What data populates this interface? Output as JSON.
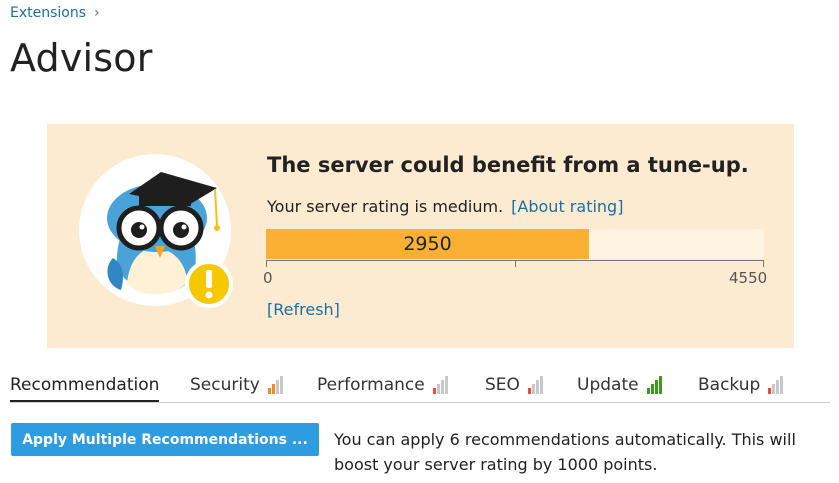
{
  "breadcrumb": {
    "root": "Extensions",
    "separator": "›"
  },
  "page": {
    "title": "Advisor"
  },
  "banner": {
    "headline": "The server could benefit from a tune-up.",
    "rating_text": "Your server rating is medium.",
    "about_link": "[About rating]",
    "refresh_link": "[Refresh]",
    "score": {
      "value": 2950,
      "label": "2950",
      "min": 0,
      "min_label": "0",
      "max": 4550,
      "max_label": "4550"
    }
  },
  "tabs": [
    {
      "label": "Recommendation",
      "active": true,
      "signal": null
    },
    {
      "label": "Security",
      "active": false,
      "signal": {
        "level": 2,
        "color": "#f0892b"
      }
    },
    {
      "label": "Performance",
      "active": false,
      "signal": {
        "level": 1,
        "color": "#e84c3d"
      }
    },
    {
      "label": "SEO",
      "active": false,
      "signal": {
        "level": 1,
        "color": "#e84c3d"
      }
    },
    {
      "label": "Update",
      "active": false,
      "signal": {
        "level": 4,
        "color": "#3c9a1f"
      }
    },
    {
      "label": "Backup",
      "active": false,
      "signal": {
        "level": 1,
        "color": "#e84c3d"
      }
    }
  ],
  "actions": {
    "apply_label": "Apply Multiple Recommendations ...",
    "info": "You can apply 6 recommendations automatically. This will boost your server rating by 1000 points."
  },
  "colors": {
    "accent": "#2d9ce0",
    "link": "#1a6fa3",
    "banner_bg": "#fdebd1",
    "bar_fill": "#fbb034",
    "warning": "#f5c800"
  }
}
